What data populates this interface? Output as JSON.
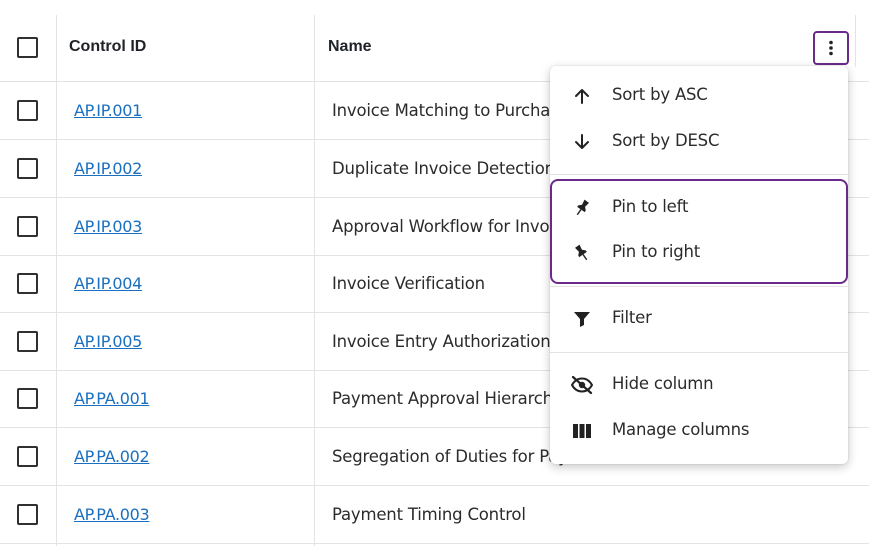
{
  "table": {
    "columns": [
      {
        "label": "Control ID"
      },
      {
        "label": "Name"
      }
    ],
    "rows": [
      {
        "id": "AP.IP.001",
        "name": "Invoice Matching to Purchase Orders"
      },
      {
        "id": "AP.IP.002",
        "name": "Duplicate Invoice Detection"
      },
      {
        "id": "AP.IP.003",
        "name": "Approval Workflow for Invoices"
      },
      {
        "id": "AP.IP.004",
        "name": "Invoice Verification"
      },
      {
        "id": "AP.IP.005",
        "name": "Invoice Entry Authorization"
      },
      {
        "id": "AP.PA.001",
        "name": "Payment Approval Hierarchy"
      },
      {
        "id": "AP.PA.002",
        "name": "Segregation of Duties for Payments"
      },
      {
        "id": "AP.PA.003",
        "name": "Payment Timing Control"
      }
    ]
  },
  "column_menu": {
    "items": [
      {
        "label": "Sort by ASC",
        "icon": "arrow-up-icon"
      },
      {
        "label": "Sort by DESC",
        "icon": "arrow-down-icon"
      },
      {
        "label": "Pin to left",
        "icon": "pin-left-icon"
      },
      {
        "label": "Pin to right",
        "icon": "pin-right-icon"
      },
      {
        "label": "Filter",
        "icon": "filter-icon"
      },
      {
        "label": "Hide column",
        "icon": "eye-off-icon"
      },
      {
        "label": "Manage columns",
        "icon": "columns-icon"
      }
    ]
  },
  "colors": {
    "link": "#1a6fbf",
    "highlight": "#6b2a8a",
    "border": "#e3e3e3"
  }
}
